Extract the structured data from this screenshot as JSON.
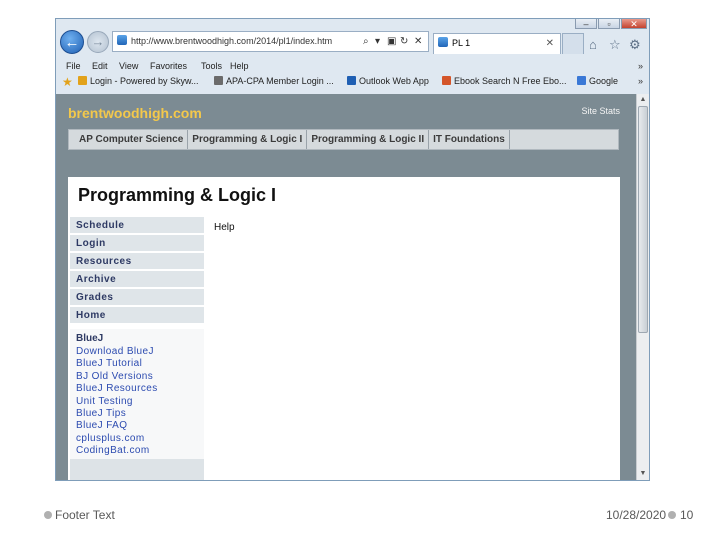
{
  "browser": {
    "address": "http://www.brentwoodhigh.com/2014/pl1/index.htm",
    "tab_title": "PL 1",
    "tab_close": "✕",
    "menu": [
      "File",
      "Edit",
      "View",
      "Favorites",
      "Tools",
      "Help"
    ],
    "menu_chevron": "»",
    "favorites": [
      {
        "label": "Login - Powered by Skyw...",
        "color": "#e2a21b"
      },
      {
        "label": "APA-CPA Member Login ...",
        "color": "#6b6b6b"
      },
      {
        "label": "Outlook Web App",
        "color": "#1f5fb3"
      },
      {
        "label": "Ebook Search N Free Ebo...",
        "color": "#d4552a"
      },
      {
        "label": "Google",
        "color": "#3a78d6"
      }
    ],
    "favorites_chevron": "»"
  },
  "site": {
    "name": "brentwoodhigh.com",
    "stats_link": "Site Stats",
    "nav": [
      "AP Computer Science",
      "Programming & Logic I",
      "Programming & Logic II",
      "IT Foundations"
    ],
    "page_title": "Programming & Logic I",
    "sidebar": [
      "Schedule",
      "Login",
      "Resources",
      "Archive",
      "Grades",
      "Home"
    ],
    "sub_heading": "BlueJ",
    "sub_links": [
      "Download BlueJ",
      "BlueJ Tutorial",
      "BJ Old Versions",
      "BlueJ Resources",
      "Unit Testing",
      "BlueJ Tips",
      "BlueJ FAQ",
      "cplusplus.com",
      "CodingBat.com"
    ],
    "help_text": "Help"
  },
  "slide": {
    "footer_text": "Footer Text",
    "date": "10/28/2020",
    "page_number": "10"
  },
  "colors": {
    "site_name": "#f3c84b",
    "page_background": "#7c8b93",
    "link": "#2c4bb0"
  }
}
